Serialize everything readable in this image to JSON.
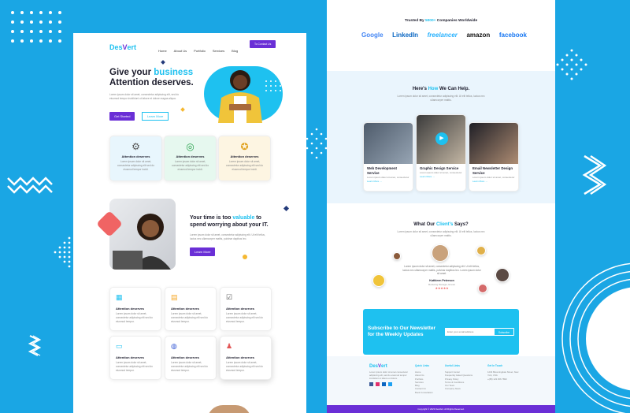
{
  "left_page": {
    "logo": {
      "part1": "Des",
      "part2": "V",
      "part3": "ert"
    },
    "nav": [
      "Home",
      "About Us",
      "Portfolio",
      "Services",
      "Blog"
    ],
    "nav_button": "To Contact Us",
    "hero": {
      "title_line1": "Give your",
      "title_highlight": "business",
      "title_line2": "Attention deserves.",
      "text": "Lorem ipsum dolor sit amet, consectetur adipiscing elit, sed do eiusmod tempor incididunt ut labore et dolore magna aliqua.",
      "primary_button": "Get Started",
      "secondary_button": "Learn More"
    },
    "features": [
      {
        "title": "Attention deserves",
        "text": "Lorem ipsum dolor sit amet, consectetur adipiscing elit sed do eiusmod tempor incidi.",
        "icon": "network-icon",
        "bg": "#e8f6fd"
      },
      {
        "title": "Attention deserves",
        "text": "Lorem ipsum dolor sit amet, consectetur adipiscing elit sed do eiusmod tempor incidi.",
        "icon": "target-icon",
        "bg": "#e6f8ef"
      },
      {
        "title": "Attention deserves",
        "text": "Lorem ipsum dolor sit amet, consectetur adipiscing elit sed do eiusmod tempor incidi.",
        "icon": "medal-icon",
        "bg": "#fdf5e2"
      }
    ],
    "about": {
      "title_part1": "Your time is too",
      "title_highlight": "valuable",
      "title_part2": "to",
      "title_line2": "spend worrying about  your IT.",
      "text": "Lorem ipsum dolor sit amet, consectetur adipiscing elit. Ut elit tellus, luctus nec ullamcorper mattis, pulvinar dapibus leo.",
      "button": "Learn More"
    },
    "services": [
      {
        "title": "Attention deserves",
        "text": "Lorem ipsum dolor sit amet, consectetur adipiscing elit sed do eiusmod tempor.",
        "icon": "analytics-icon"
      },
      {
        "title": "Attention deserves",
        "text": "Lorem ipsum dolor sit amet, consectetur adipiscing elit sed do eiusmod tempor.",
        "icon": "wallet-icon"
      },
      {
        "title": "Attention deserves",
        "text": "Lorem ipsum dolor sit amet, consectetur adipiscing elit sed do eiusmod tempor.",
        "icon": "checklist-icon"
      },
      {
        "title": "Attention deserves",
        "text": "Lorem ipsum dolor sit amet, consectetur adipiscing elit sed do eiusmod tempor.",
        "icon": "monitor-icon"
      },
      {
        "title": "Attention deserves",
        "text": "Lorem ipsum dolor sit amet, consectetur adipiscing elit sed do eiusmod tempor.",
        "icon": "globe-icon"
      },
      {
        "title": "Attention deserves",
        "text": "Lorem ipsum dolor sit amet, consectetur adipiscing elit sed do eiusmod tempor.",
        "icon": "user-badge-icon"
      }
    ]
  },
  "right_page": {
    "trusted": {
      "prefix": "Trusted By",
      "count": "5000+",
      "suffix": "Companies Worldwide"
    },
    "brands": [
      "Google",
      "LinkedIn",
      "freelancer",
      "amazon",
      "facebook"
    ],
    "help": {
      "prefix": "Here's",
      "highlight": "How",
      "suffix": "We Can Help.",
      "text": "Lorem ipsum dolor sit amet, consectetur adipiscing elit. Ut elit tellus, luctus nec ullamcorper mattis."
    },
    "help_cards": [
      {
        "title": "Web Development Service",
        "text": "Lorem ipsum dolor sit amet, consectetur",
        "link": "Learn More →"
      },
      {
        "title": "Graphic Design Service",
        "text": "Lorem ipsum dolor sit amet, consectetur",
        "link": "Learn More →"
      },
      {
        "title": "Email Newsletter Design Service",
        "text": "Lorem ipsum dolor sit amet, consectetur",
        "link": "Learn More →"
      }
    ],
    "testimonials": {
      "prefix": "What Our",
      "highlight": "Client's",
      "suffix": "Says?",
      "text": "Lorem ipsum dolor sit amet, consectetur adipiscing elit. Ut elit tellus, luctus nec ullamcorper mattis.",
      "quote": "Lorem ipsum dolor sit amet, consectetur adipiscing elit. Ut elit tellus, luctus nec ullamcorper mattis, pulvinar dapibus leo. Lorem ipsum dolor sit amet.",
      "name": "Kathleen Peterson",
      "role": "Marketing Manager, Envato",
      "stars": "★★★★★"
    },
    "newsletter": {
      "title_line1": "Subscribe to Our Newsletter",
      "title_line2": "for the Weekly Updates",
      "placeholder": "Enter your email address",
      "button": "Subscribe"
    },
    "footer": {
      "text": "Lorem ipsum dolor sit amet consectetur adipiscing elit, sed do eiusmod tempor incididunt ut labore et dolore.",
      "col1": {
        "title": "Quick Links",
        "items": [
          "Home",
          "About Us",
          "Portfolio",
          "Services",
          "Blog",
          "Contact Us",
          "Book Consultation"
        ]
      },
      "col2": {
        "title": "Useful Links",
        "items": [
          "Support Center",
          "Frequently Asked Questions",
          "Privacy Policy",
          "Terms & Conditions",
          "Our Team",
          "Company News"
        ]
      },
      "col3": {
        "title": "Get In Touch",
        "items": [
          "1234 Bloomingdale Street, New York, USA",
          "+(88) 123 456 7890"
        ]
      },
      "copyright": "Copyright © 2023 DesVert. All Rights Reserved."
    }
  },
  "colors": {
    "accent": "#1ec1f0",
    "purple": "#6a2fd6",
    "bg_blue": "#1aa6e4"
  }
}
